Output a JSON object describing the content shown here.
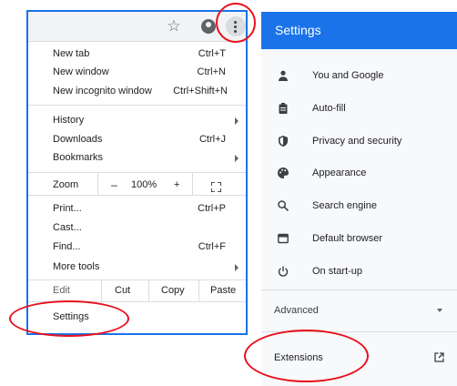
{
  "menu": {
    "toolbar": {
      "star_icon": "☆"
    },
    "items": [
      {
        "label": "New tab",
        "shortcut": "Ctrl+T"
      },
      {
        "label": "New window",
        "shortcut": "Ctrl+N"
      },
      {
        "label": "New incognito window",
        "shortcut": "Ctrl+Shift+N"
      },
      {
        "label": "History",
        "shortcut": ""
      },
      {
        "label": "Downloads",
        "shortcut": "Ctrl+J"
      },
      {
        "label": "Bookmarks",
        "shortcut": ""
      }
    ],
    "zoom": {
      "label": "Zoom",
      "minus": "–",
      "value": "100%",
      "plus": "+"
    },
    "items2": [
      {
        "label": "Print...",
        "shortcut": "Ctrl+P"
      },
      {
        "label": "Cast...",
        "shortcut": ""
      },
      {
        "label": "Find...",
        "shortcut": "Ctrl+F"
      },
      {
        "label": "More tools",
        "shortcut": ""
      }
    ],
    "edit": {
      "label": "Edit",
      "cut": "Cut",
      "copy": "Copy",
      "paste": "Paste"
    },
    "settings": "Settings"
  },
  "settings": {
    "title": "Settings",
    "nav": [
      {
        "label": "You and Google",
        "icon": "person-icon"
      },
      {
        "label": "Auto-fill",
        "icon": "clipboard-icon"
      },
      {
        "label": "Privacy and security",
        "icon": "shield-icon"
      },
      {
        "label": "Appearance",
        "icon": "palette-icon"
      },
      {
        "label": "Search engine",
        "icon": "search-icon"
      },
      {
        "label": "Default browser",
        "icon": "browser-icon"
      },
      {
        "label": "On start-up",
        "icon": "power-icon"
      }
    ],
    "advanced": "Advanced",
    "extensions": "Extensions"
  },
  "colors": {
    "accent": "#1a73e8",
    "highlight_circle": "#e8101c"
  }
}
